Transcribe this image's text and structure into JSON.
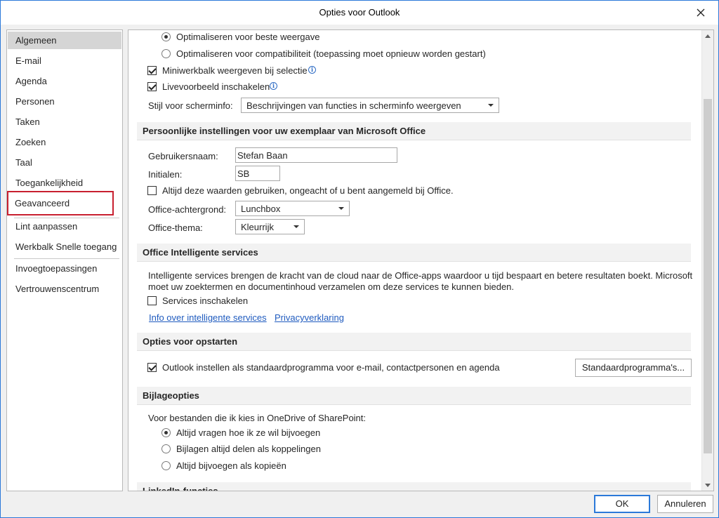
{
  "window": {
    "title": "Opties voor Outlook"
  },
  "sidebar": {
    "items": [
      {
        "label": "Algemeen"
      },
      {
        "label": "E-mail"
      },
      {
        "label": "Agenda"
      },
      {
        "label": "Personen"
      },
      {
        "label": "Taken"
      },
      {
        "label": "Zoeken"
      },
      {
        "label": "Taal"
      },
      {
        "label": "Toegankelijkheid"
      },
      {
        "label": "Geavanceerd"
      },
      {
        "label": "Lint aanpassen"
      },
      {
        "label": "Werkbalk Snelle toegang"
      },
      {
        "label": "Invoegtoepassingen"
      },
      {
        "label": "Vertrouwenscentrum"
      }
    ],
    "selected": "Algemeen",
    "highlighted": "Geavanceerd",
    "highlight_color": "#c8202f"
  },
  "ui_options": {
    "radio_best": "Optimaliseren voor beste weergave",
    "radio_compat": "Optimaliseren voor compatibiliteit (toepassing moet opnieuw worden gestart)",
    "mini_toolbar": "Miniwerkbalk weergeven bij selectie",
    "live_preview": "Livevoorbeeld inschakelen",
    "tooltip_label": "Stijl voor scherminfo:",
    "tooltip_value": "Beschrijvingen van functies in scherminfo weergeven",
    "selected_radio": "best",
    "mini_toolbar_checked": true,
    "live_preview_checked": true
  },
  "personal": {
    "header": "Persoonlijke instellingen voor uw exemplaar van Microsoft Office",
    "username_label": "Gebruikersnaam:",
    "username_value": "Stefan Baan",
    "initials_label": "Initialen:",
    "initials_value": "SB",
    "always_use": "Altijd deze waarden gebruiken, ongeacht of u bent aangemeld bij Office.",
    "always_use_checked": false,
    "background_label": "Office-achtergrond:",
    "background_value": "Lunchbox",
    "theme_label": "Office-thema:",
    "theme_value": "Kleurrijk"
  },
  "intelligent": {
    "header": "Office Intelligente services",
    "desc_line1": "Intelligente services brengen de kracht van de cloud naar de Office-apps waardoor u tijd bespaart en betere resultaten boekt. Microsoft",
    "desc_line2": "moet uw zoektermen en documentinhoud verzamelen om deze services te kunnen bieden.",
    "enable": "Services inschakelen",
    "enable_checked": false,
    "link_info": "Info over intelligente services",
    "link_privacy": "Privacyverklaring"
  },
  "startup": {
    "header": "Opties voor opstarten",
    "default_program": "Outlook instellen als standaardprogramma voor e-mail, contactpersonen en agenda",
    "default_checked": true,
    "button": "Standaardprogramma's..."
  },
  "attachments": {
    "header": "Bijlageopties",
    "intro": "Voor bestanden die ik kies in OneDrive of SharePoint:",
    "opt_ask": "Altijd vragen hoe ik ze wil bijvoegen",
    "opt_share": "Bijlagen altijd delen als koppelingen",
    "opt_copy": "Altijd bijvoegen als kopieën",
    "selected": "ask"
  },
  "next_section": {
    "header": "LinkedIn-functies"
  },
  "footer": {
    "ok": "OK",
    "cancel": "Annuleren"
  },
  "colors": {
    "accent": "#2b79d9",
    "link": "#1f5bbf",
    "section_bg": "#f2f2f2"
  }
}
